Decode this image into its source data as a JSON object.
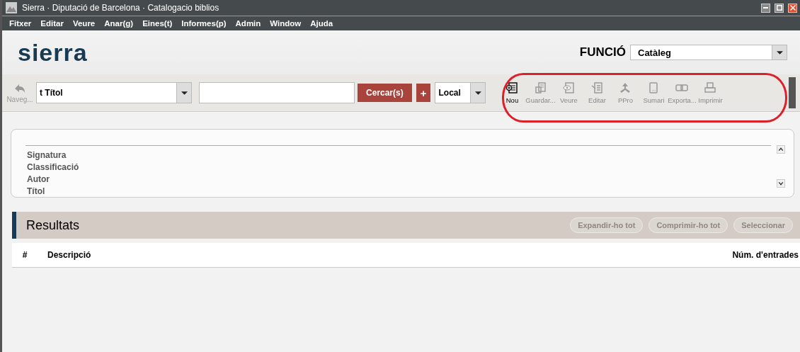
{
  "window": {
    "title": "Sierra · Diputació de Barcelona · Catalogacio biblios"
  },
  "menu": [
    "Fitxer",
    "Editar",
    "Veure",
    "Anar(g)",
    "Eines(t)",
    "Informes(p)",
    "Admin",
    "Window",
    "Ajuda"
  ],
  "header": {
    "logo": "sierra",
    "function_label": "FUNCIÓ",
    "function_value": "Catàleg"
  },
  "search_bar": {
    "back_label": "Naveg...",
    "index_value": "t Títol",
    "search_button": "Cercar(s)",
    "add_button": "+",
    "scope_value": "Local"
  },
  "toolbar": [
    {
      "label": "Nou",
      "kind": "new",
      "disabled": false
    },
    {
      "label": "Guardar...",
      "kind": "save",
      "disabled": true
    },
    {
      "label": "Veure",
      "kind": "view",
      "disabled": true
    },
    {
      "label": "Editar",
      "kind": "edit",
      "disabled": true
    },
    {
      "label": "PPro",
      "kind": "ppro",
      "disabled": true
    },
    {
      "label": "Sumari",
      "kind": "summary",
      "disabled": true
    },
    {
      "label": "Exporta...",
      "kind": "export",
      "disabled": true
    },
    {
      "label": "Imprimir",
      "kind": "print",
      "disabled": true
    }
  ],
  "search_fields": [
    "Signatura",
    "Classificació",
    "Autor",
    "Títol"
  ],
  "results": {
    "title": "Resultats",
    "buttons": [
      {
        "label": "Expandir-ho tot",
        "disabled": true
      },
      {
        "label": "Comprimir-ho tot",
        "disabled": true
      },
      {
        "label": "Seleccionar",
        "disabled": true
      }
    ],
    "columns": [
      "#",
      "Descripció",
      "Núm. d'entrades"
    ]
  }
}
